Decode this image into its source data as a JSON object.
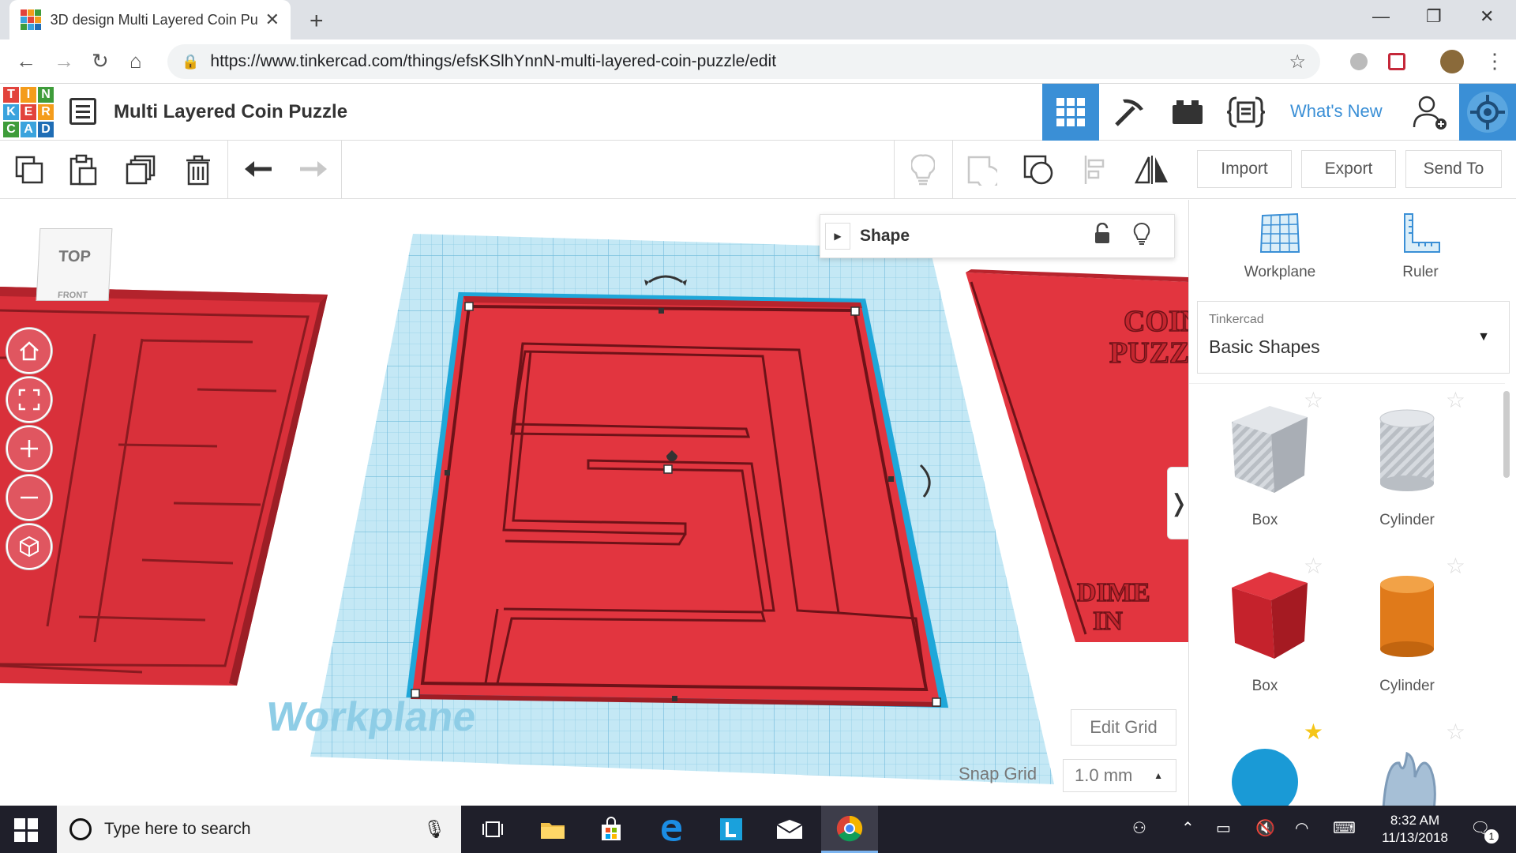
{
  "browser": {
    "tab_title": "3D design Multi Layered Coin Pu",
    "tab_close": "✕",
    "new_tab": "+",
    "url": "https://www.tinkercad.com/things/efsKSlhYnnN-multi-layered-coin-puzzle/edit",
    "window_controls": {
      "minimize": "—",
      "maximize": "❐",
      "close": "✕"
    }
  },
  "tinkercad": {
    "logo_letters": [
      "T",
      "I",
      "N",
      "K",
      "E",
      "R",
      "C",
      "A",
      "D"
    ],
    "logo_colors": [
      "#e2433c",
      "#f49c1b",
      "#3e9c3a",
      "#3aa3dd",
      "#e2433c",
      "#f49c1b",
      "#3e9c3a",
      "#3aa3dd",
      "#1f6db5"
    ],
    "design_title": "Multi Layered Coin Puzzle",
    "whats_new": "What's New",
    "accent": "#3a8fd6"
  },
  "toolbar": {
    "import": "Import",
    "export": "Export",
    "send_to": "Send To"
  },
  "viewport": {
    "viewcube_top": "TOP",
    "viewcube_front": "FRONT",
    "workplane_text": "Workplane",
    "inspector_title": "Shape",
    "edit_grid": "Edit Grid",
    "snap_grid_label": "Snap Grid",
    "snap_grid_value": "1.0 mm",
    "right_model_text_1": "COIN",
    "right_model_text_2": "PUZZ",
    "right_model_text_3": "DIME",
    "right_model_text_4": "IN",
    "model_color": "#e2353f",
    "grid_color": "#a9dcef"
  },
  "panel": {
    "workplane": "Workplane",
    "ruler": "Ruler",
    "library_owner": "Tinkercad",
    "library_name": "Basic Shapes",
    "shapes": [
      {
        "label": "Box",
        "starred": false
      },
      {
        "label": "Cylinder",
        "starred": false
      },
      {
        "label": "Box",
        "starred": false
      },
      {
        "label": "Cylinder",
        "starred": false
      },
      {
        "label": "",
        "starred": true
      },
      {
        "label": "",
        "starred": false
      }
    ]
  },
  "taskbar": {
    "search_placeholder": "Type here to search",
    "time": "8:32 AM",
    "date": "11/13/2018",
    "notification_count": "1"
  }
}
